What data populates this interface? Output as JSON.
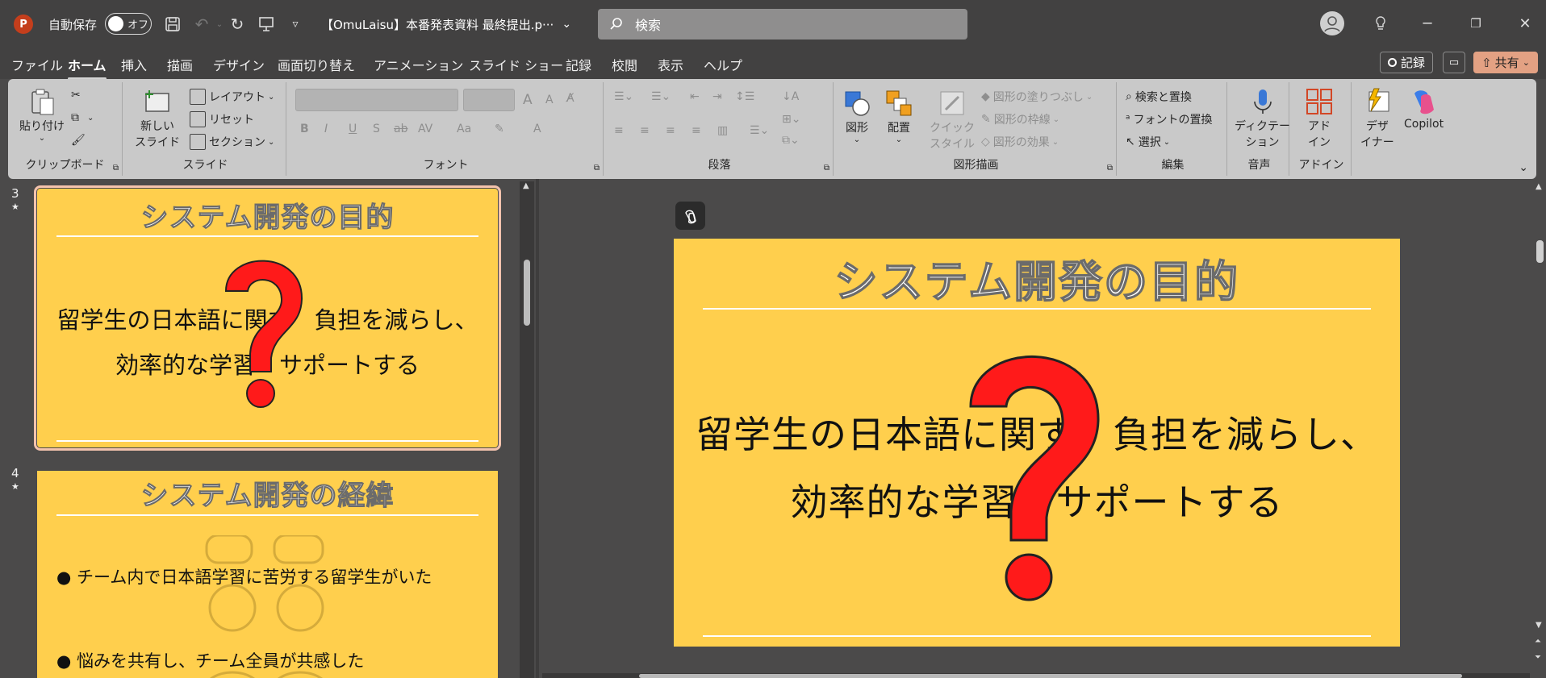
{
  "titlebar": {
    "app_logo": "P",
    "autosave_label": "自動保存",
    "autosave_state": "オフ",
    "document_title": "【OmuLaisu】本番発表資料 最終提出.p···",
    "search_placeholder": "検索"
  },
  "menu": {
    "tabs": [
      "ファイル",
      "ホーム",
      "挿入",
      "描画",
      "デザイン",
      "画面切り替え",
      "アニメーション",
      "スライド ショー",
      "記録",
      "校閲",
      "表示",
      "ヘルプ"
    ],
    "active_tab": "ホーム",
    "record_label": "記録",
    "share_label": "共有"
  },
  "ribbon": {
    "clipboard": {
      "paste": "貼り付け",
      "label": "クリップボード"
    },
    "slides": {
      "new_slide_1": "新しい",
      "new_slide_2": "スライド",
      "layout": "レイアウト",
      "reset": "リセット",
      "section": "セクション",
      "label": "スライド"
    },
    "font": {
      "label": "フォント",
      "bold": "B",
      "italic": "I",
      "underline": "U",
      "shadow": "S",
      "strike": "ab",
      "spacing": "AV",
      "case": "Aa",
      "grow": "A",
      "shrink": "A"
    },
    "paragraph": {
      "label": "段落"
    },
    "drawing": {
      "shape": "図形",
      "arrange": "配置",
      "quick_style_1": "クイック",
      "quick_style_2": "スタイル",
      "fill": "図形の塗りつぶし",
      "outline": "図形の枠線",
      "effect": "図形の効果",
      "label": "図形描画"
    },
    "editing": {
      "find_replace": "検索と置換",
      "font_replace": "フォントの置換",
      "select": "選択",
      "label": "編集"
    },
    "voice": {
      "dictate_1": "ディクテー",
      "dictate_2": "ション",
      "label": "音声"
    },
    "addins": {
      "addin_1": "アド",
      "addin_2": "イン",
      "label": "アドイン"
    },
    "designer": {
      "designer_1": "デザ",
      "designer_2": "イナー"
    },
    "copilot": {
      "label": "Copilot"
    }
  },
  "thumbnails": [
    {
      "number": "3",
      "star": "★",
      "title": "システム開発の目的",
      "lines": [
        "留学生の日本語に関す　負担を減らし、",
        "効率的な学習　サポートする"
      ]
    },
    {
      "number": "4",
      "star": "★",
      "title": "システム開発の経緯",
      "lines": [
        "チーム内で日本語学習に苦労する留学生がいた",
        "悩みを共有し、チーム全員が共感した"
      ],
      "bullet": "●"
    }
  ],
  "slide": {
    "title": "システム開発の目的",
    "body_line_1": "留学生の日本語に関す　負担を減らし、",
    "body_line_2": "効率的な学習　サポートする",
    "question_mark_color": "#ff1a1a"
  },
  "colors": {
    "slide_bg": "#ffcf4d",
    "chrome": "#424141",
    "ribbon": "#c9c9c9"
  }
}
